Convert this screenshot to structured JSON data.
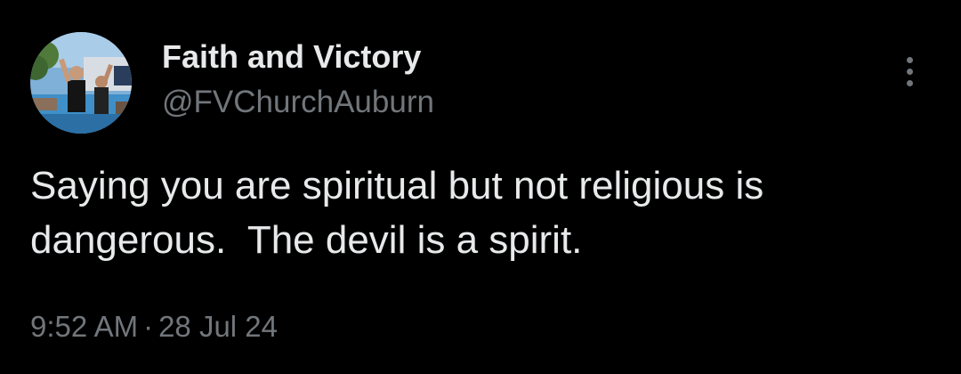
{
  "author": {
    "display_name": "Faith and Victory",
    "handle": "@FVChurchAuburn",
    "avatar_icon": "avatar-photo"
  },
  "tweet": {
    "text": "Saying you are spiritual but not religious is\ndangerous.  The devil is a spirit.",
    "time": "9:52 AM",
    "separator": "·",
    "date": "28 Jul 24"
  },
  "menu": {
    "icon": "more-vertical-icon"
  },
  "colors": {
    "background": "#000000",
    "primary_text": "#e7e9ea",
    "secondary_text": "#71767b"
  }
}
